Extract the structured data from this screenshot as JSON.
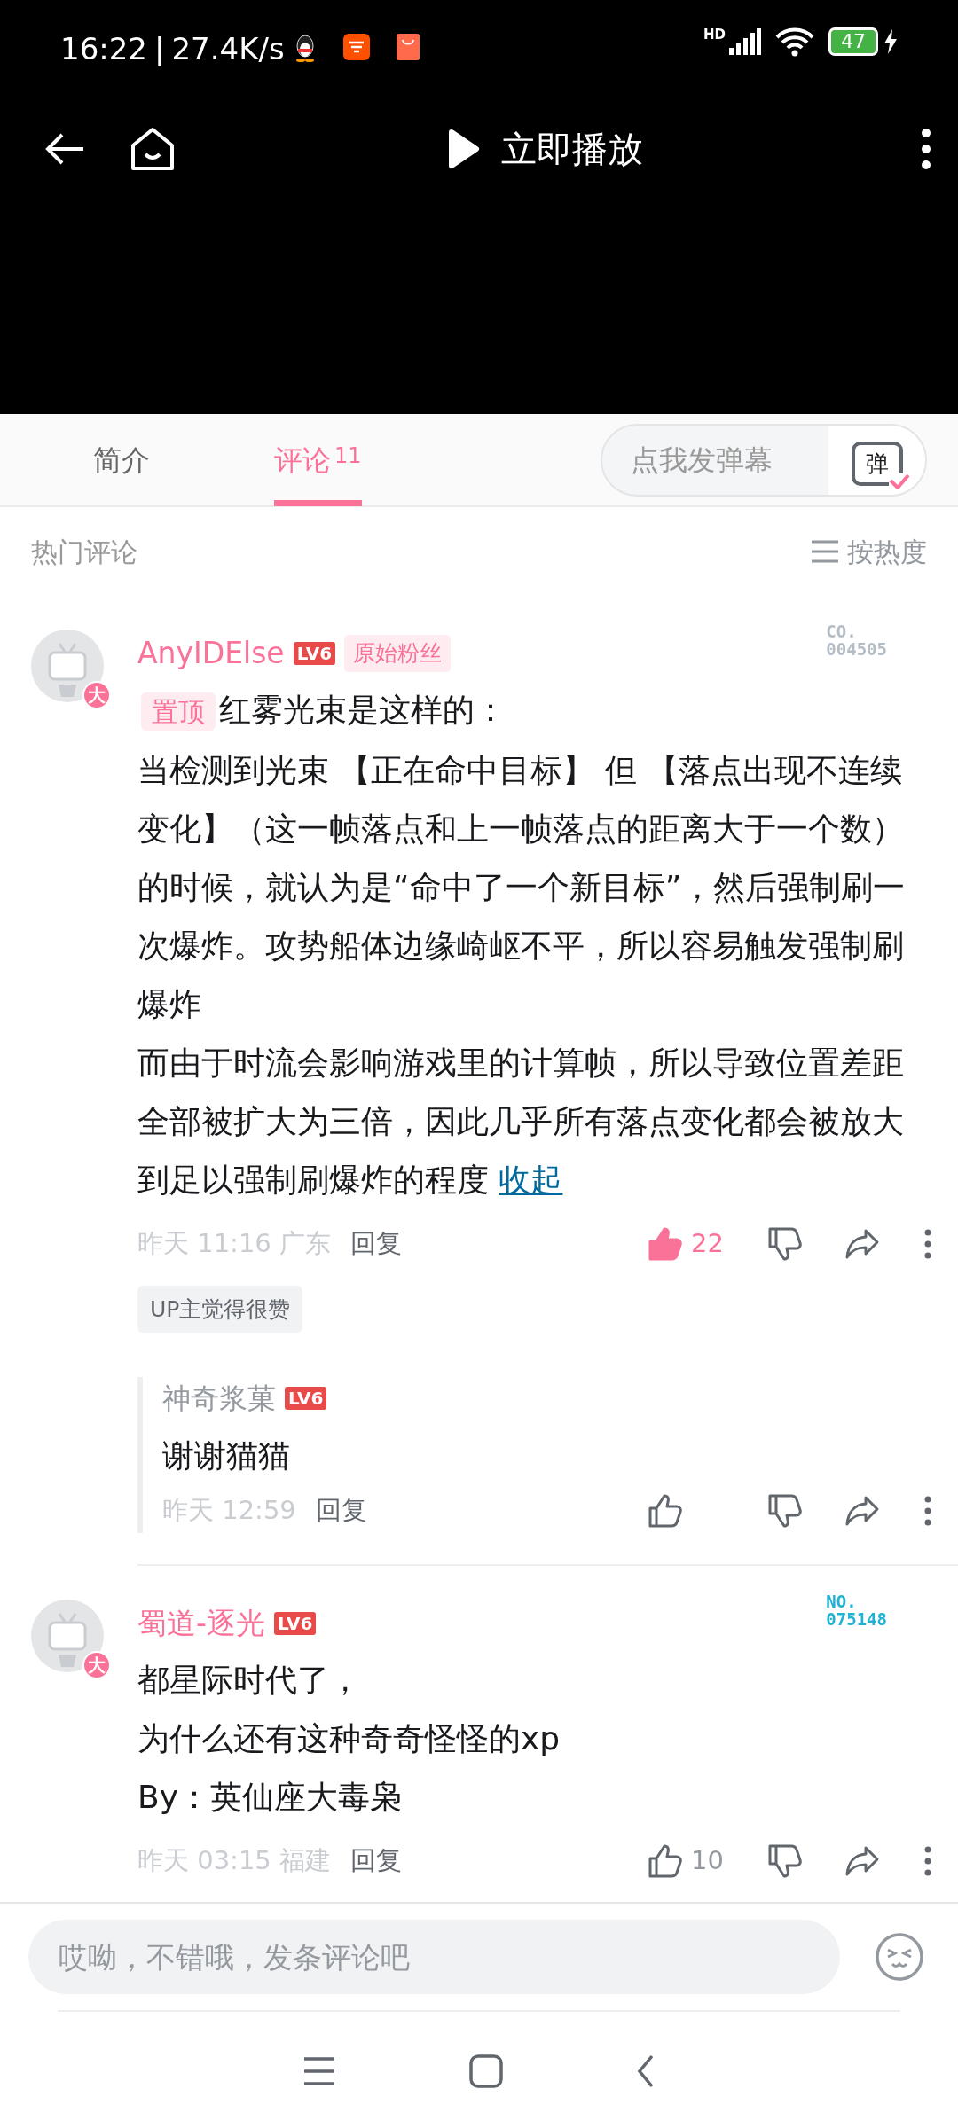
{
  "status_bar": {
    "time": "16:22",
    "separator": "|",
    "speed": "27.4K/s",
    "network": "HD",
    "battery": "47"
  },
  "top_bar": {
    "play_label": "立即播放"
  },
  "tabs": [
    {
      "label": "简介",
      "selected": false
    },
    {
      "label": "评论",
      "count": "11",
      "selected": true
    }
  ],
  "danmaku": {
    "placeholder": "点我发弹幕",
    "button": "弹"
  },
  "comments_header": {
    "title": "热门评论",
    "sort": "按热度"
  },
  "comments": [
    {
      "username": "AnyIDElse",
      "level": "LV6",
      "fan_badge": "原始粉丝",
      "fan_number": {
        "label": "CO.",
        "number": "004505",
        "color": "#b4bcc6"
      },
      "avatar_badge": "大",
      "pinned_label": "置顶",
      "paragraphs": [
        "红雾光束是这样的：",
        "当检测到光束 【正在命中目标】 但 【落点出现不连续变化】（这一帧落点和上一帧落点的距离大于一个数）的时候，就认为是“命中了一个新目标”，然后强制刷一次爆炸。攻势船体边缘崎岖不平，所以容易触发强制刷爆炸",
        "而由于时流会影响游戏里的计算帧，所以导致位置差距全部被扩大为三倍，因此几乎所有落点变化都会被放大到足以强制刷爆炸的程度"
      ],
      "collapse_link": "收起",
      "time": "昨天 11:16",
      "location": "广东",
      "reply_label": "回复",
      "liked": true,
      "likes": "22",
      "up_liked": "UP主觉得很赞",
      "replies": [
        {
          "username": "神奇浆菓",
          "level": "LV6",
          "paragraphs": [
            "谢谢猫猫"
          ],
          "time": "昨天 12:59",
          "reply_label": "回复",
          "liked": false
        }
      ]
    },
    {
      "username": "蜀道-逐光",
      "level": "LV6",
      "fan_number": {
        "label": "NO.",
        "number": "075148",
        "color": "#1fb2d3"
      },
      "avatar_badge": "大",
      "paragraphs": [
        "都星际时代了，",
        "为什么还有这种奇奇怪怪的xp",
        "By：英仙座大毒枭"
      ],
      "time": "昨天 03:15",
      "location": "福建",
      "reply_label": "回复",
      "liked": false,
      "likes": "10"
    }
  ],
  "composer": {
    "placeholder": "哎呦，不错哦，发条评论吧"
  }
}
